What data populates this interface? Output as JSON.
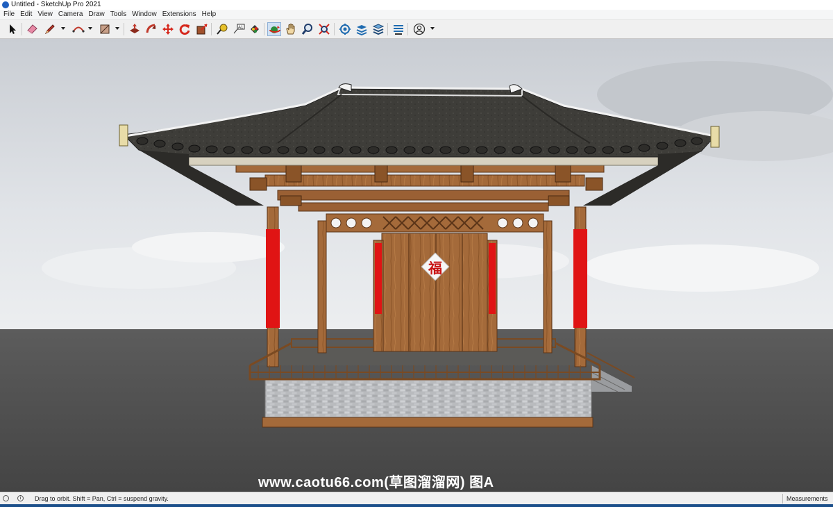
{
  "window": {
    "title": "Untitled - SketchUp Pro 2021"
  },
  "menu": [
    "File",
    "Edit",
    "View",
    "Camera",
    "Draw",
    "Tools",
    "Window",
    "Extensions",
    "Help"
  ],
  "toolbar": {
    "tools": [
      "select-icon",
      "eraser-icon",
      "pencil-icon",
      "arc-icon",
      "rectangle-icon",
      "push-pull-icon",
      "follow-me-icon",
      "move-icon",
      "rotate-icon",
      "scale-icon",
      "tape-measure-icon",
      "text-icon",
      "paint-bucket-icon",
      "orbit-icon",
      "pan-icon",
      "zoom-icon",
      "zoom-extents-icon",
      "components-icon",
      "layers-icon",
      "styles-icon",
      "shadows-icon",
      "account-icon"
    ],
    "active_tool": "orbit-icon"
  },
  "scene": {
    "door_character": "福",
    "sky_color": "#d9dde2",
    "ground_color": "#505050",
    "pillar_red": "#e01414",
    "wood_color": "#a46a3a",
    "roof_color": "#3e3d39"
  },
  "watermark": "www.caotu66.com(草图溜溜网) 图A",
  "status": {
    "hint": "Drag to orbit. Shift = Pan, Ctrl = suspend gravity.",
    "measurements_label": "Measurements"
  }
}
